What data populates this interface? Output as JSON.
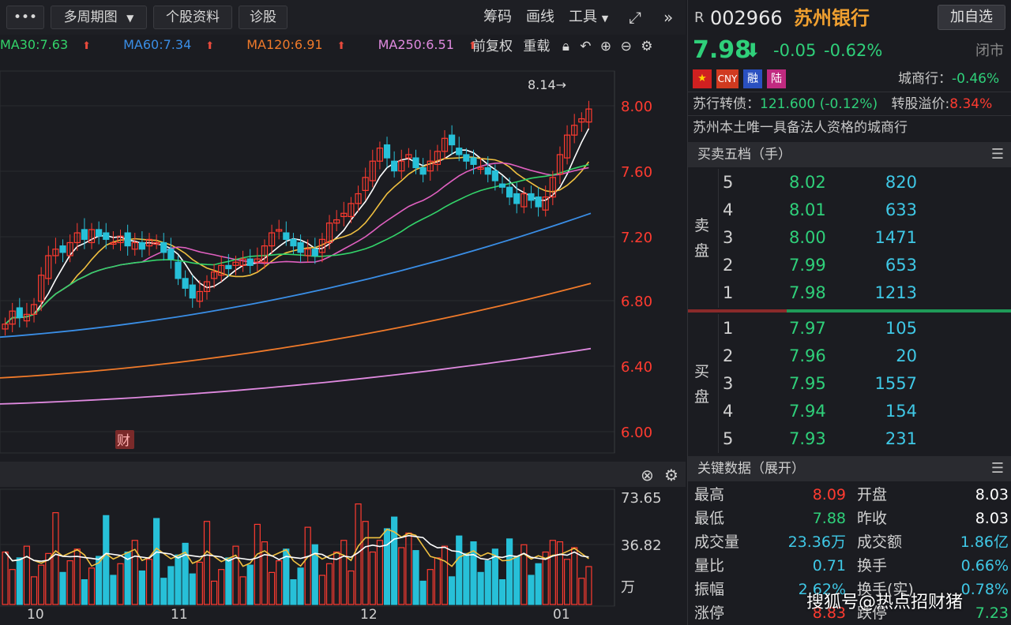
{
  "toolbar": {
    "more_label": "•••",
    "multi_period_label": "多周期图",
    "stock_info_label": "个股资料",
    "diagnose_label": "诊股",
    "chips_label": "筹码",
    "draw_label": "画线",
    "tools_label": "工具",
    "fullscreen_icon": "expand-icon",
    "collapse_icon": "double-chevron-right-icon"
  },
  "ma_legend": [
    {
      "label": "MA30:7.63",
      "color": "#33d46a"
    },
    {
      "label": "MA60:7.34",
      "color": "#3a8ee6"
    },
    {
      "label": "MA120:6.91",
      "color": "#f07a2a"
    },
    {
      "label": "MA250:6.51",
      "color": "#e08ae0"
    }
  ],
  "chart_tools": {
    "adjust_label": "前复权",
    "overlay_label": "重载"
  },
  "price_axis": [
    "8.00",
    "7.60",
    "7.20",
    "6.80",
    "6.40",
    "6.00"
  ],
  "high_annotation": "8.14→",
  "finance_badge": "财",
  "volume_axis": [
    "73.65",
    "36.82",
    "万"
  ],
  "date_axis": [
    "10",
    "11",
    "12",
    "01"
  ],
  "stock": {
    "prefix": "R",
    "code": "002966",
    "name": "苏州银行",
    "add_button": "加自选",
    "price": "7.98",
    "change": "-0.05",
    "change_pct": "-0.62%",
    "status": "闭市",
    "tags": [
      "CNY",
      "融",
      "陆"
    ],
    "sector": "城商行：",
    "sector_change": "-0.46%",
    "bond_label": "苏行转债：",
    "bond_value": "121.600 (-0.12%)",
    "premium_label": "转股溢价:",
    "premium_value": "8.34%",
    "description": "苏州本土唯一具备法人资格的城商行"
  },
  "orderbook": {
    "title": "买卖五档（手）",
    "sell_label": [
      "卖",
      "盘"
    ],
    "buy_label": [
      "买",
      "盘"
    ],
    "sells": [
      {
        "idx": "5",
        "price": "8.02",
        "vol": "820"
      },
      {
        "idx": "4",
        "price": "8.01",
        "vol": "633"
      },
      {
        "idx": "3",
        "price": "8.00",
        "vol": "1471"
      },
      {
        "idx": "2",
        "price": "7.99",
        "vol": "653"
      },
      {
        "idx": "1",
        "price": "7.98",
        "vol": "1213"
      }
    ],
    "buys": [
      {
        "idx": "1",
        "price": "7.97",
        "vol": "105"
      },
      {
        "idx": "2",
        "price": "7.96",
        "vol": "20"
      },
      {
        "idx": "3",
        "price": "7.95",
        "vol": "1557"
      },
      {
        "idx": "4",
        "price": "7.94",
        "vol": "154"
      },
      {
        "idx": "5",
        "price": "7.93",
        "vol": "231"
      }
    ]
  },
  "key_data": {
    "title": "关键数据（展开）",
    "rows": [
      {
        "l1": "最高",
        "v1": "8.09",
        "c1": "red",
        "l2": "开盘",
        "v2": "8.03",
        "c2": "white"
      },
      {
        "l1": "最低",
        "v1": "7.88",
        "c1": "green",
        "l2": "昨收",
        "v2": "8.03",
        "c2": "white"
      },
      {
        "l1": "成交量",
        "v1": "23.36万",
        "c1": "cyan",
        "l2": "成交额",
        "v2": "1.86亿",
        "c2": "cyan"
      },
      {
        "l1": "量比",
        "v1": "0.71",
        "c1": "cyan",
        "l2": "换手",
        "v2": "0.66%",
        "c2": "cyan"
      },
      {
        "l1": "振幅",
        "v1": "2.62%",
        "c1": "cyan",
        "l2": "换手(实)",
        "v2": "0.78%",
        "c2": "cyan"
      },
      {
        "l1": "涨停",
        "v1": "8.83",
        "c1": "red",
        "l2": "跌停",
        "v2": "7.23",
        "c2": "green"
      }
    ]
  },
  "watermark": "搜狐号@热点招财猪",
  "colors": {
    "up": "#ff3b30",
    "down": "#2fd07a",
    "ma5": "#ffffff",
    "ma10": "#f0c040",
    "ma20": "#e060c0",
    "ma30": "#33d46a",
    "ma60": "#3a8ee6",
    "ma120": "#f07a2a",
    "ma250": "#e08ae0"
  }
}
